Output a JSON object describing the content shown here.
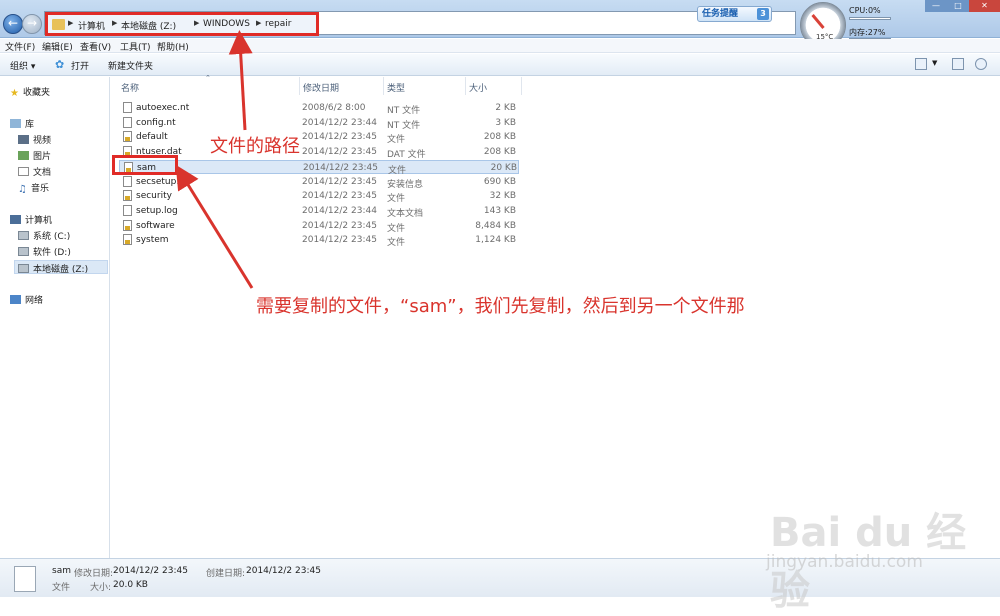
{
  "address": {
    "segments": [
      "计算机",
      "本地磁盘 (Z:)",
      "WINDOWS",
      "repair"
    ]
  },
  "titlebar_widgets": {
    "task_reminder_label": "任务提醒",
    "task_reminder_count": "3",
    "gauge_temp": "15°C",
    "cpu_label": "CPU:0%",
    "cpu_fraction": 0.0,
    "mem_label": "内存:27%",
    "mem_fraction": 0.27
  },
  "menu": {
    "items": [
      "文件(F)",
      "编辑(E)",
      "查看(V)",
      "工具(T)",
      "帮助(H)"
    ]
  },
  "toolbar": {
    "organize_label": "组织 ▾",
    "open_label": "打开",
    "new_folder_label": "新建文件夹"
  },
  "nav": {
    "favorites": "收藏夹",
    "libraries": "库",
    "library_items": [
      "视频",
      "图片",
      "文档",
      "音乐"
    ],
    "computer": "计算机",
    "drives": [
      "系统 (C:)",
      "软件 (D:)",
      "本地磁盘 (Z:)"
    ],
    "network": "网络"
  },
  "file_list": {
    "columns": [
      "名称",
      "修改日期",
      "类型",
      "大小"
    ],
    "rows": [
      {
        "name": "autoexec.nt",
        "date": "2008/6/2 8:00",
        "type": "NT 文件",
        "size": "2 KB"
      },
      {
        "name": "config.nt",
        "date": "2014/12/2 23:44",
        "type": "NT 文件",
        "size": "3 KB"
      },
      {
        "name": "default",
        "date": "2014/12/2 23:45",
        "type": "文件",
        "size": "208 KB"
      },
      {
        "name": "ntuser.dat",
        "date": "2014/12/2 23:45",
        "type": "DAT 文件",
        "size": "208 KB"
      },
      {
        "name": "sam",
        "date": "2014/12/2 23:45",
        "type": "文件",
        "size": "20 KB"
      },
      {
        "name": "secsetup.inf",
        "date": "2014/12/2 23:45",
        "type": "安装信息",
        "size": "690 KB"
      },
      {
        "name": "security",
        "date": "2014/12/2 23:45",
        "type": "文件",
        "size": "32 KB"
      },
      {
        "name": "setup.log",
        "date": "2014/12/2 23:44",
        "type": "文本文档",
        "size": "143 KB"
      },
      {
        "name": "software",
        "date": "2014/12/2 23:45",
        "type": "文件",
        "size": "8,484 KB"
      },
      {
        "name": "system",
        "date": "2014/12/2 23:45",
        "type": "文件",
        "size": "1,124 KB"
      }
    ],
    "selected_index": 4
  },
  "annotations": {
    "path_note": "文件的路径",
    "copy_note": "需要复制的文件，“sam”，我们先复制，然后到另一个文件那"
  },
  "details": {
    "name": "sam",
    "modified_label": "修改日期:",
    "modified_value": "2014/12/2 23:45",
    "created_label": "创建日期:",
    "created_value": "2014/12/2 23:45",
    "type_value": "文件",
    "size_label": "大小:",
    "size_value": "20.0 KB"
  },
  "watermark": {
    "logo": "Bai du 经验",
    "url": "jingyan.baidu.com"
  },
  "colors": {
    "annotation_red": "#d9342d",
    "selection_blue": "#dbe8f7"
  }
}
